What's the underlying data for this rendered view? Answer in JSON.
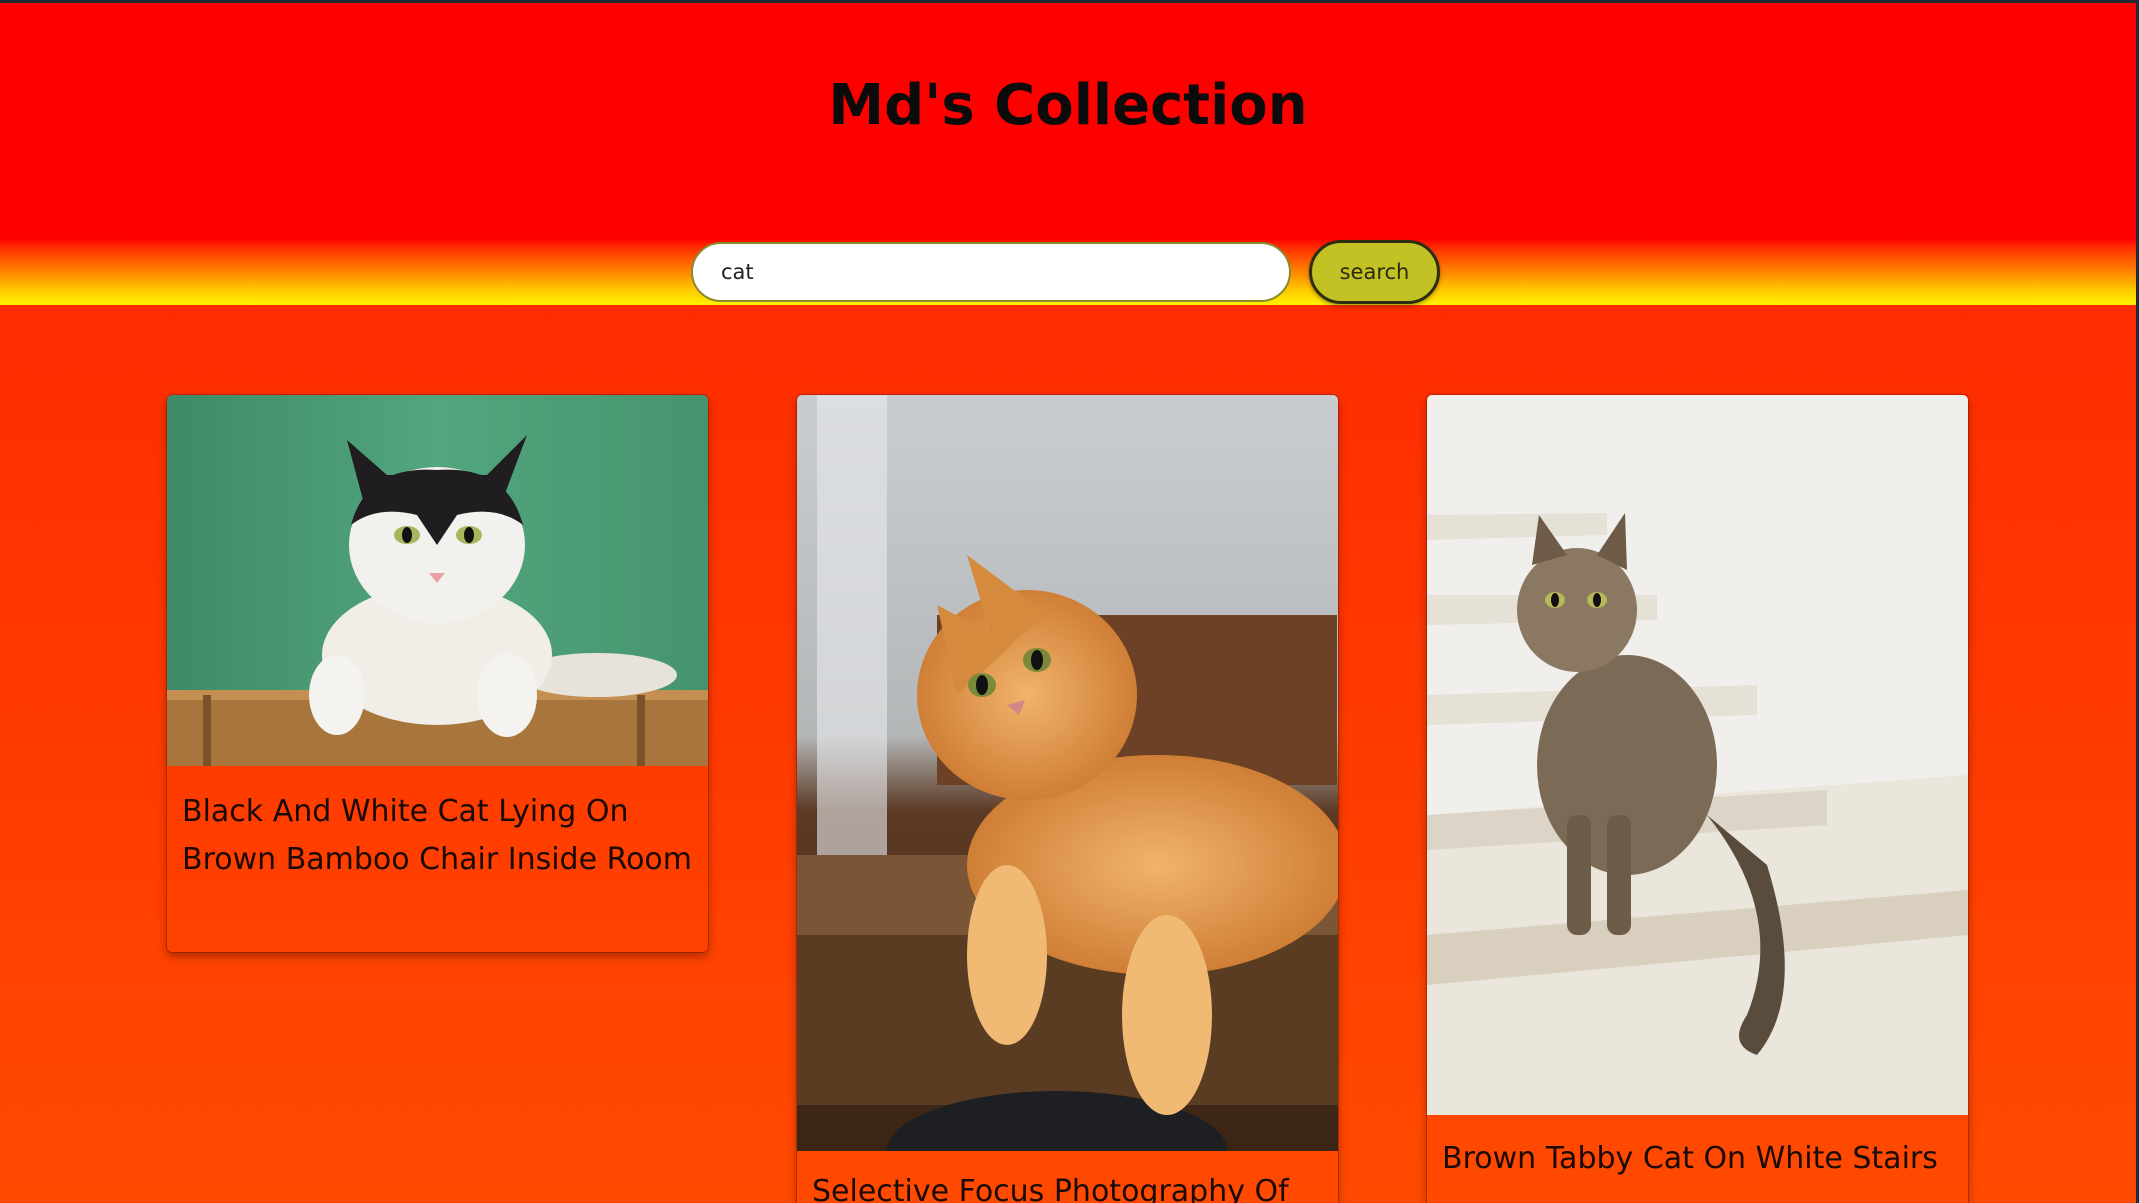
{
  "header": {
    "title": "Md's Collection"
  },
  "search": {
    "value": "cat",
    "button_label": "search"
  },
  "results": [
    {
      "caption": "Black And White Cat Lying On Brown Bamboo Chair Inside Room",
      "image_icon": "black-and-white-cat-photo"
    },
    {
      "caption": "Selective Focus Photography Of",
      "image_icon": "orange-cat-photo"
    },
    {
      "caption": "Brown Tabby Cat On White Stairs",
      "image_icon": "tabby-cat-photo"
    }
  ],
  "colors": {
    "header_red": "#ff0000",
    "header_yellow": "#fff200",
    "background_orange": "#ff3a00",
    "button_olive": "#c3c224"
  }
}
